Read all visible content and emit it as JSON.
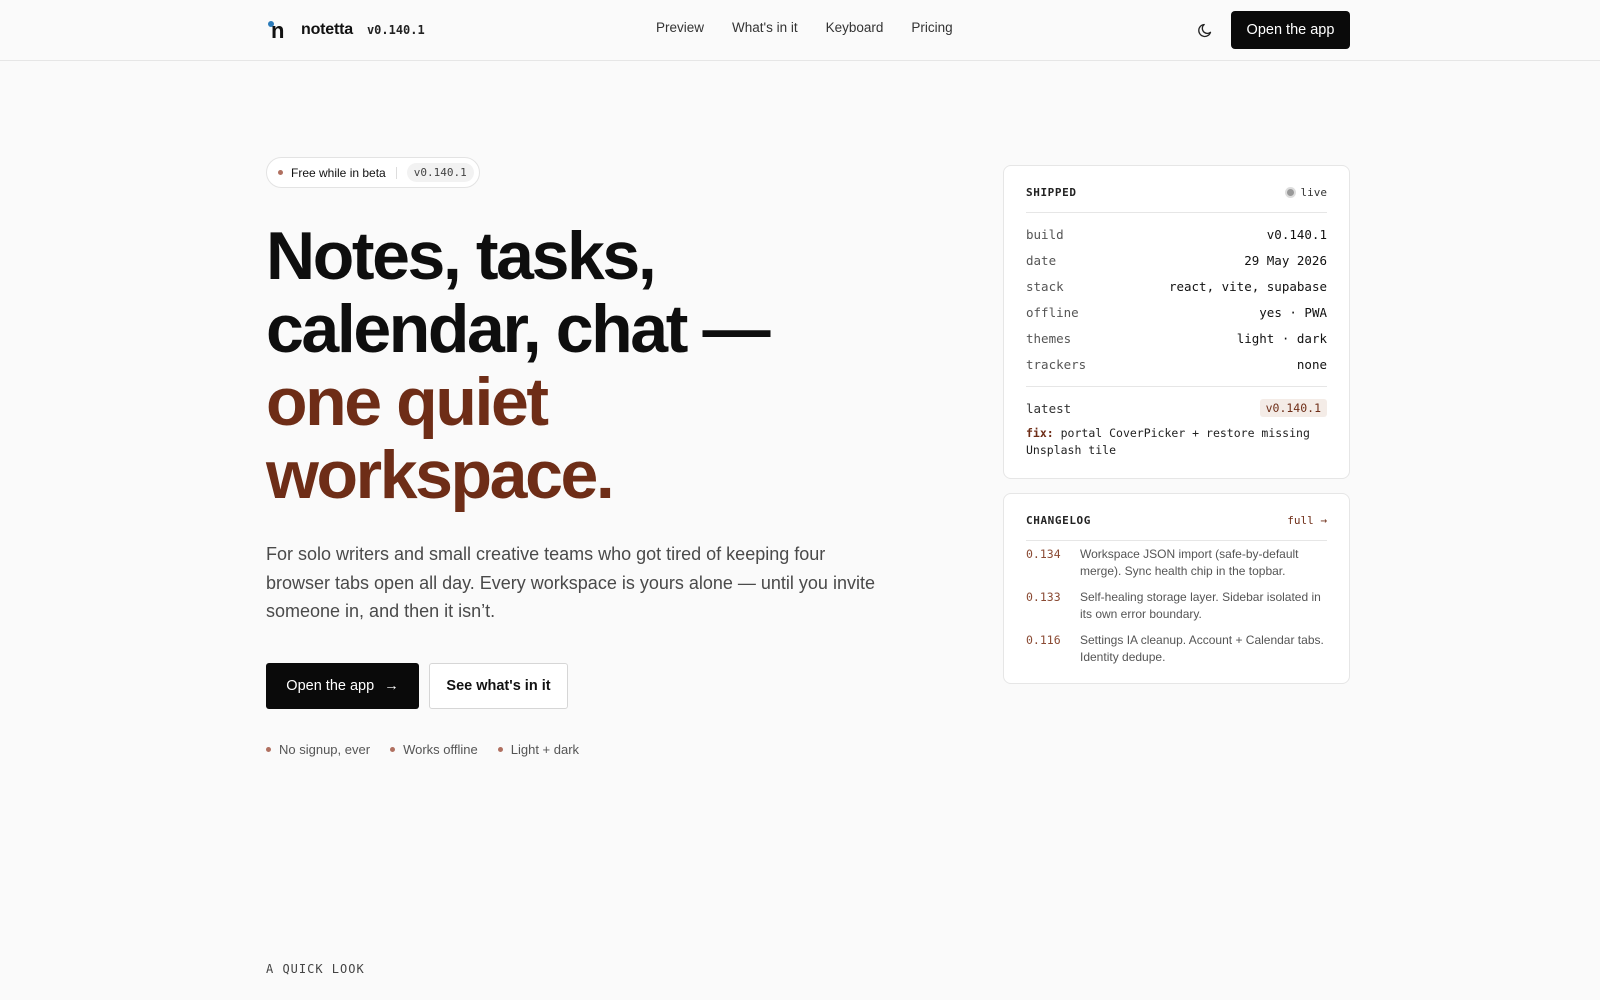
{
  "header": {
    "logo_letter": "n",
    "brand_name": "notetta",
    "version": "v0.140.1",
    "nav": [
      {
        "label": "Preview"
      },
      {
        "label": "What's in it"
      },
      {
        "label": "Keyboard"
      },
      {
        "label": "Pricing"
      }
    ],
    "theme_icon": "moon-icon",
    "cta_label": "Open the app"
  },
  "hero": {
    "pill_label": "Free while in beta",
    "pill_version": "v0.140.1",
    "headline_line1": "Notes, tasks,",
    "headline_line2": "calendar, chat —",
    "headline_accent1": "one quiet",
    "headline_accent2": "workspace.",
    "subheading": "For solo writers and small creative teams who got tired of keeping four browser tabs open all day. Every workspace is yours alone — until you invite someone in, and then it isn’t.",
    "primary_cta": "Open the app",
    "primary_cta_arrow": "→",
    "secondary_cta": "See what's in it",
    "perks": [
      "No signup, ever",
      "Works offline",
      "Light + dark"
    ]
  },
  "shipped": {
    "title": "SHIPPED",
    "status": "live",
    "rows": [
      {
        "key": "build",
        "value": "v0.140.1"
      },
      {
        "key": "date",
        "value": "29 May 2026"
      },
      {
        "key": "stack",
        "value": "react, vite, supabase"
      },
      {
        "key": "offline",
        "value": "yes · PWA"
      },
      {
        "key": "themes",
        "value": "light · dark"
      },
      {
        "key": "trackers",
        "value": "none"
      }
    ],
    "latest_label": "latest",
    "latest_version": "v0.140.1",
    "fix_prefix": "fix:",
    "fix_text": " portal CoverPicker + restore missing Unsplash tile"
  },
  "changelog": {
    "title": "CHANGELOG",
    "full_link": "full →",
    "entries": [
      {
        "version": "0.134",
        "text": "Workspace JSON import (safe-by-default merge). Sync health chip in the topbar."
      },
      {
        "version": "0.133",
        "text": "Self-healing storage layer. Sidebar isolated in its own error boundary."
      },
      {
        "version": "0.116",
        "text": "Settings IA cleanup. Account + Calendar tabs. Identity dedupe."
      }
    ]
  },
  "quick_look": {
    "label": "A QUICK LOOK"
  },
  "colors": {
    "accent": "#6e2d17",
    "logo_dot": "#2b7bb9",
    "button_dark": "#0a0a0a"
  }
}
